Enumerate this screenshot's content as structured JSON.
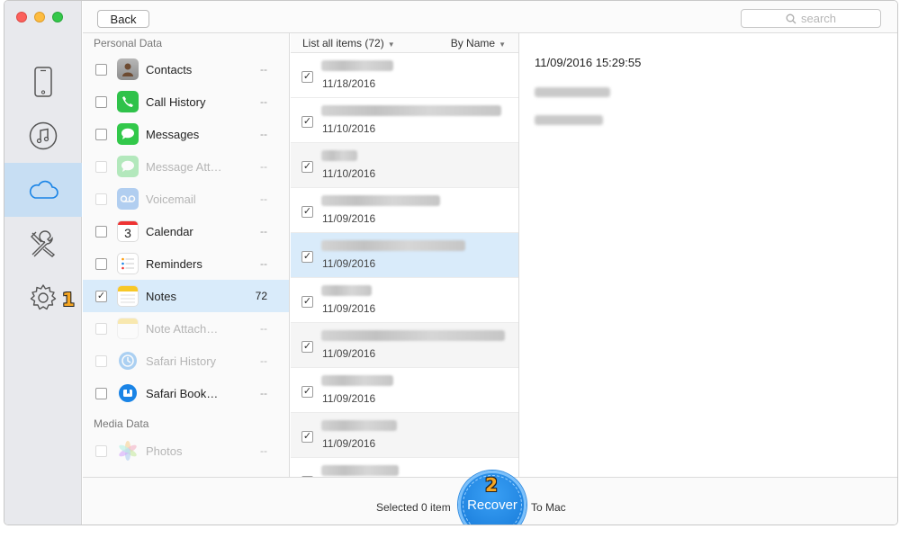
{
  "toolbar": {
    "back_label": "Back",
    "search_placeholder": "search"
  },
  "rail": {
    "annotation_1": "1"
  },
  "categories": {
    "personal_heading": "Personal Data",
    "media_heading": "Media Data",
    "items": [
      {
        "label": "Contacts",
        "count": "--",
        "checked": false,
        "disabled": false,
        "icon": "contacts-icon"
      },
      {
        "label": "Call History",
        "count": "--",
        "checked": false,
        "disabled": false,
        "icon": "phone-icon"
      },
      {
        "label": "Messages",
        "count": "--",
        "checked": false,
        "disabled": false,
        "icon": "messages-icon"
      },
      {
        "label": "Message Att…",
        "count": "--",
        "checked": false,
        "disabled": true,
        "icon": "message-attachment-icon"
      },
      {
        "label": "Voicemail",
        "count": "--",
        "checked": false,
        "disabled": true,
        "icon": "voicemail-icon"
      },
      {
        "label": "Calendar",
        "count": "--",
        "checked": false,
        "disabled": false,
        "icon": "calendar-icon",
        "calendar_day": "3"
      },
      {
        "label": "Reminders",
        "count": "--",
        "checked": false,
        "disabled": false,
        "icon": "reminders-icon"
      },
      {
        "label": "Notes",
        "count": "72",
        "checked": true,
        "disabled": false,
        "selected": true,
        "icon": "notes-icon"
      },
      {
        "label": "Note Attach…",
        "count": "--",
        "checked": false,
        "disabled": true,
        "icon": "note-attachment-icon"
      },
      {
        "label": "Safari History",
        "count": "--",
        "checked": false,
        "disabled": true,
        "icon": "safari-history-icon"
      },
      {
        "label": "Safari Book…",
        "count": "--",
        "checked": false,
        "disabled": false,
        "icon": "safari-bookmark-icon"
      }
    ],
    "media_items": [
      {
        "label": "Photos",
        "count": "--",
        "checked": false,
        "disabled": true,
        "icon": "photos-icon"
      }
    ]
  },
  "list": {
    "filter_label": "List all items (72)",
    "sort_label": "By Name",
    "rows": [
      {
        "date": "11/18/2016",
        "checked": true
      },
      {
        "date": "11/10/2016",
        "checked": true
      },
      {
        "date": "11/10/2016",
        "checked": true
      },
      {
        "date": "11/09/2016",
        "checked": true
      },
      {
        "date": "11/09/2016",
        "checked": true,
        "selected": true
      },
      {
        "date": "11/09/2016",
        "checked": true
      },
      {
        "date": "11/09/2016",
        "checked": true
      },
      {
        "date": "11/09/2016",
        "checked": true
      },
      {
        "date": "11/09/2016",
        "checked": true
      },
      {
        "date": "",
        "checked": true
      }
    ]
  },
  "detail": {
    "timestamp": "11/09/2016 15:29:55"
  },
  "footer": {
    "selected_text": "Selected 0 item",
    "recover_label": "Recover",
    "to_mac_label": "To Mac",
    "annotation_2": "2"
  },
  "colors": {
    "accent": "#1a84e6",
    "selection": "#d9ebfa",
    "rail_active": "#c7def3",
    "annotation": "#f5a623"
  }
}
